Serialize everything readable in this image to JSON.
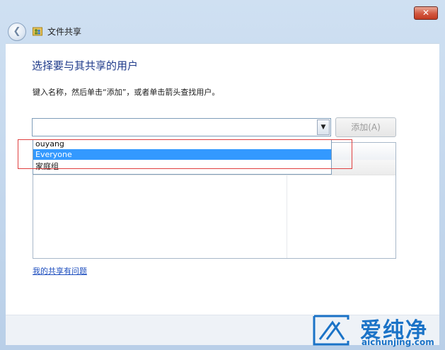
{
  "window": {
    "title": "文件共享",
    "close_symbol": "✕",
    "back_symbol": "❮"
  },
  "main": {
    "heading": "选择要与其共享的用户",
    "instruction": "键入名称，然后单击“添加”，或者单击箭头查找用户。",
    "combo_value": "",
    "combo_arrow": "▼",
    "add_button": "添加(A)",
    "dropdown_items": [
      "ouyang",
      "Everyone",
      "家庭组"
    ],
    "selected_item": "Everyone",
    "help_link": "我的共享有问题"
  },
  "watermark": {
    "cn": "爱纯净",
    "url": "aichunjing.com"
  },
  "colors": {
    "accent": "#3399ff",
    "link": "#1f4fbf",
    "heading": "#1e3a8a",
    "highlight_box": "#e04040",
    "brand": "#1b73c7"
  },
  "icons": [
    "back-arrow-icon",
    "users-folder-icon",
    "close-icon",
    "dropdown-arrow-icon",
    "watermark-logo-icon"
  ]
}
